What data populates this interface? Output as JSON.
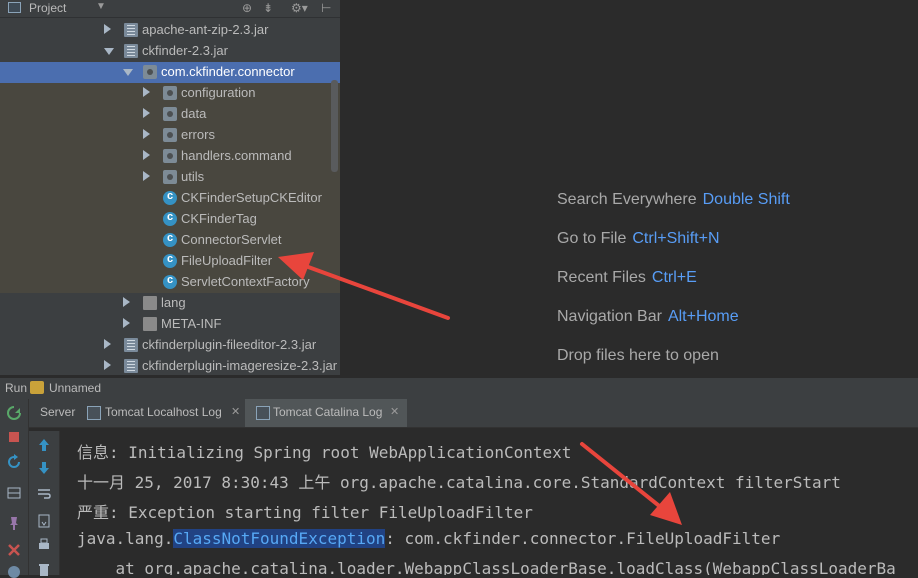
{
  "project_panel": {
    "title": "Project",
    "tree": [
      {
        "label": "apache-ant-zip-2.3.jar",
        "type": "jar",
        "depth": 0,
        "expanded": false
      },
      {
        "label": "ckfinder-2.3.jar",
        "type": "jar",
        "depth": 0,
        "expanded": true
      },
      {
        "label": "com.ckfinder.connector",
        "type": "package",
        "depth": 1,
        "expanded": true,
        "selected": true
      },
      {
        "label": "configuration",
        "type": "package",
        "depth": 2,
        "expanded": false
      },
      {
        "label": "data",
        "type": "package",
        "depth": 2,
        "expanded": false
      },
      {
        "label": "errors",
        "type": "package",
        "depth": 2,
        "expanded": false
      },
      {
        "label": "handlers.command",
        "type": "package",
        "depth": 2,
        "expanded": false
      },
      {
        "label": "utils",
        "type": "package",
        "depth": 2,
        "expanded": false
      },
      {
        "label": "CKFinderSetupCKEditor",
        "type": "class",
        "depth": 2
      },
      {
        "label": "CKFinderTag",
        "type": "class",
        "depth": 2
      },
      {
        "label": "ConnectorServlet",
        "type": "class",
        "depth": 2
      },
      {
        "label": "FileUploadFilter",
        "type": "class",
        "depth": 2
      },
      {
        "label": "ServletContextFactory",
        "type": "class",
        "depth": 2
      },
      {
        "label": "lang",
        "type": "folder",
        "depth": 1,
        "expanded": false
      },
      {
        "label": "META-INF",
        "type": "folder",
        "depth": 1,
        "expanded": false
      },
      {
        "label": "ckfinderplugin-fileeditor-2.3.jar",
        "type": "jar",
        "depth": 0,
        "expanded": false
      },
      {
        "label": "ckfinderplugin-imageresize-2.3.jar",
        "type": "jar",
        "depth": 0,
        "expanded": false
      }
    ]
  },
  "editor_hints": [
    {
      "text": "Search Everywhere",
      "shortcut": "Double Shift"
    },
    {
      "text": "Go to File",
      "shortcut": "Ctrl+Shift+N"
    },
    {
      "text": "Recent Files",
      "shortcut": "Ctrl+E"
    },
    {
      "text": "Navigation Bar",
      "shortcut": "Alt+Home"
    },
    {
      "text": "Drop files here to open",
      "shortcut": ""
    }
  ],
  "run_window": {
    "label": "Run",
    "config_name": "Unnamed",
    "tabs": [
      {
        "label": "Server",
        "active": false
      },
      {
        "label": "Tomcat Localhost Log",
        "active": false
      },
      {
        "label": "Tomcat Catalina Log",
        "active": true
      }
    ]
  },
  "console": {
    "lines": [
      {
        "text": "信息: Initializing Spring root WebApplicationContext"
      },
      {
        "text": "十一月 25, 2017 8:30:43 上午 org.apache.catalina.core.StandardContext filterStart"
      },
      {
        "text": "严重: Exception starting filter FileUploadFilter"
      },
      {
        "pre": "java.lang.",
        "highlight": "ClassNotFoundException",
        "post": ": com.ckfinder.connector.FileUploadFilter"
      },
      {
        "text": "    at org.apache.catalina.loader.WebappClassLoaderBase.loadClass(WebappClassLoaderBa"
      }
    ]
  },
  "colors": {
    "selection": "#4b6eaf",
    "shortcut_blue": "#589df6",
    "annotation_arrow": "#e8453c",
    "highlight_bg": "#214283"
  }
}
